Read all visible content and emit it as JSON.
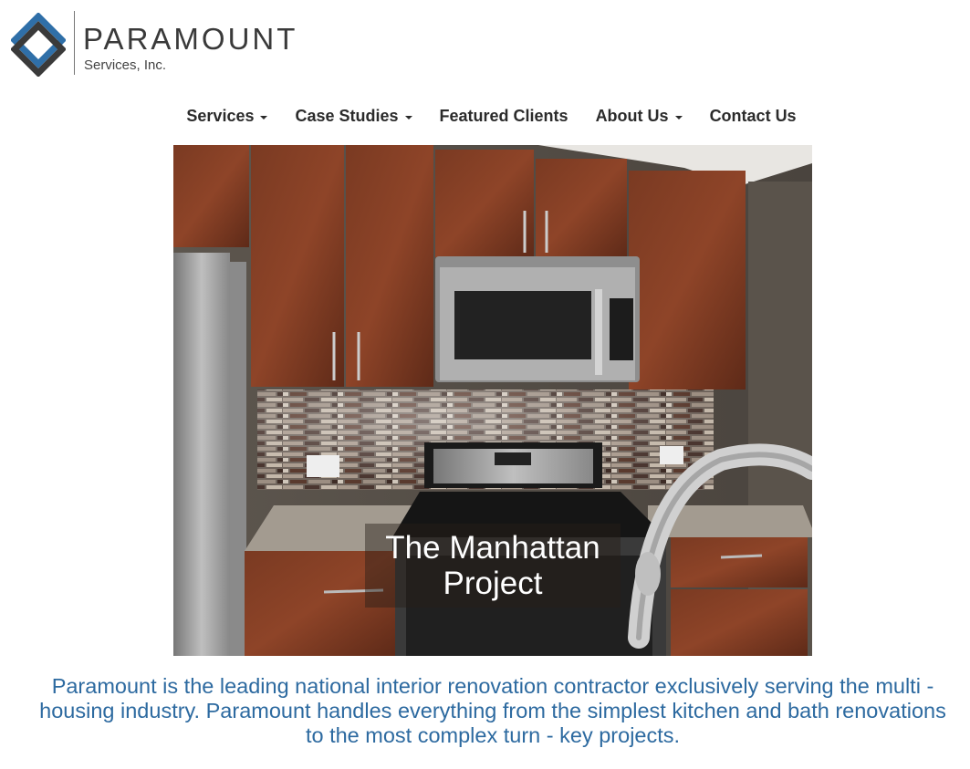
{
  "logo": {
    "brand": "PARAMOUNT",
    "subtitle": "Services, Inc.",
    "colors": {
      "blue": "#2f6fa8",
      "dark": "#3a3a3a"
    }
  },
  "nav": {
    "items": [
      {
        "label": "Services",
        "dropdown": true
      },
      {
        "label": "Case Studies",
        "dropdown": true
      },
      {
        "label": "Featured Clients",
        "dropdown": false
      },
      {
        "label": "About Us",
        "dropdown": true
      },
      {
        "label": "Contact Us",
        "dropdown": false
      }
    ]
  },
  "hero": {
    "caption_line1": "The Manhattan",
    "caption_line2": "Project"
  },
  "description": "Paramount is the leading national interior renovation contractor exclusively serving the multi - housing industry. Paramount handles everything from the simplest kitchen and bath renovations to the most complex turn - key projects.",
  "colors": {
    "accent": "#2d6aa0",
    "nav_text": "#2b2b2b"
  }
}
